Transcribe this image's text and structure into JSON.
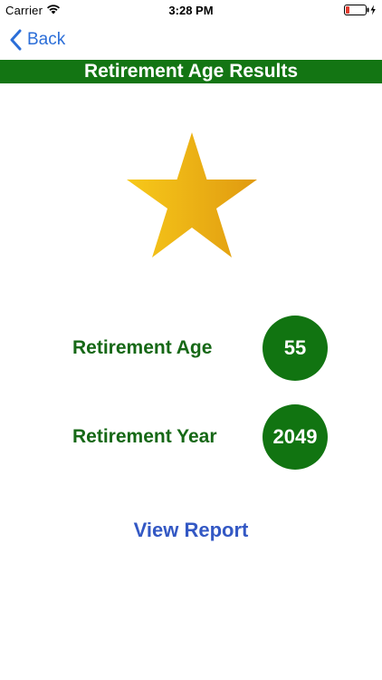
{
  "status_bar": {
    "carrier": "Carrier",
    "time": "3:28 PM",
    "icons": [
      "wifi-icon",
      "battery-icon",
      "charging-bolt-icon"
    ],
    "battery_level": 0.15
  },
  "nav": {
    "back_label": "Back",
    "back_icon": "chevron-left-icon",
    "accent_color": "#2b6ed8"
  },
  "header": {
    "title": "Retirement Age Results",
    "background_color": "#137513"
  },
  "hero": {
    "icon": "star-icon",
    "gradient": [
      "#f5c518",
      "#e09a10"
    ]
  },
  "results": {
    "age": {
      "label": "Retirement Age",
      "value": "55"
    },
    "year": {
      "label": "Retirement Year",
      "value": "2049"
    },
    "label_color": "#166816",
    "badge_color": "#117411"
  },
  "actions": {
    "view_report_label": "View Report",
    "link_color": "#3358c4"
  }
}
